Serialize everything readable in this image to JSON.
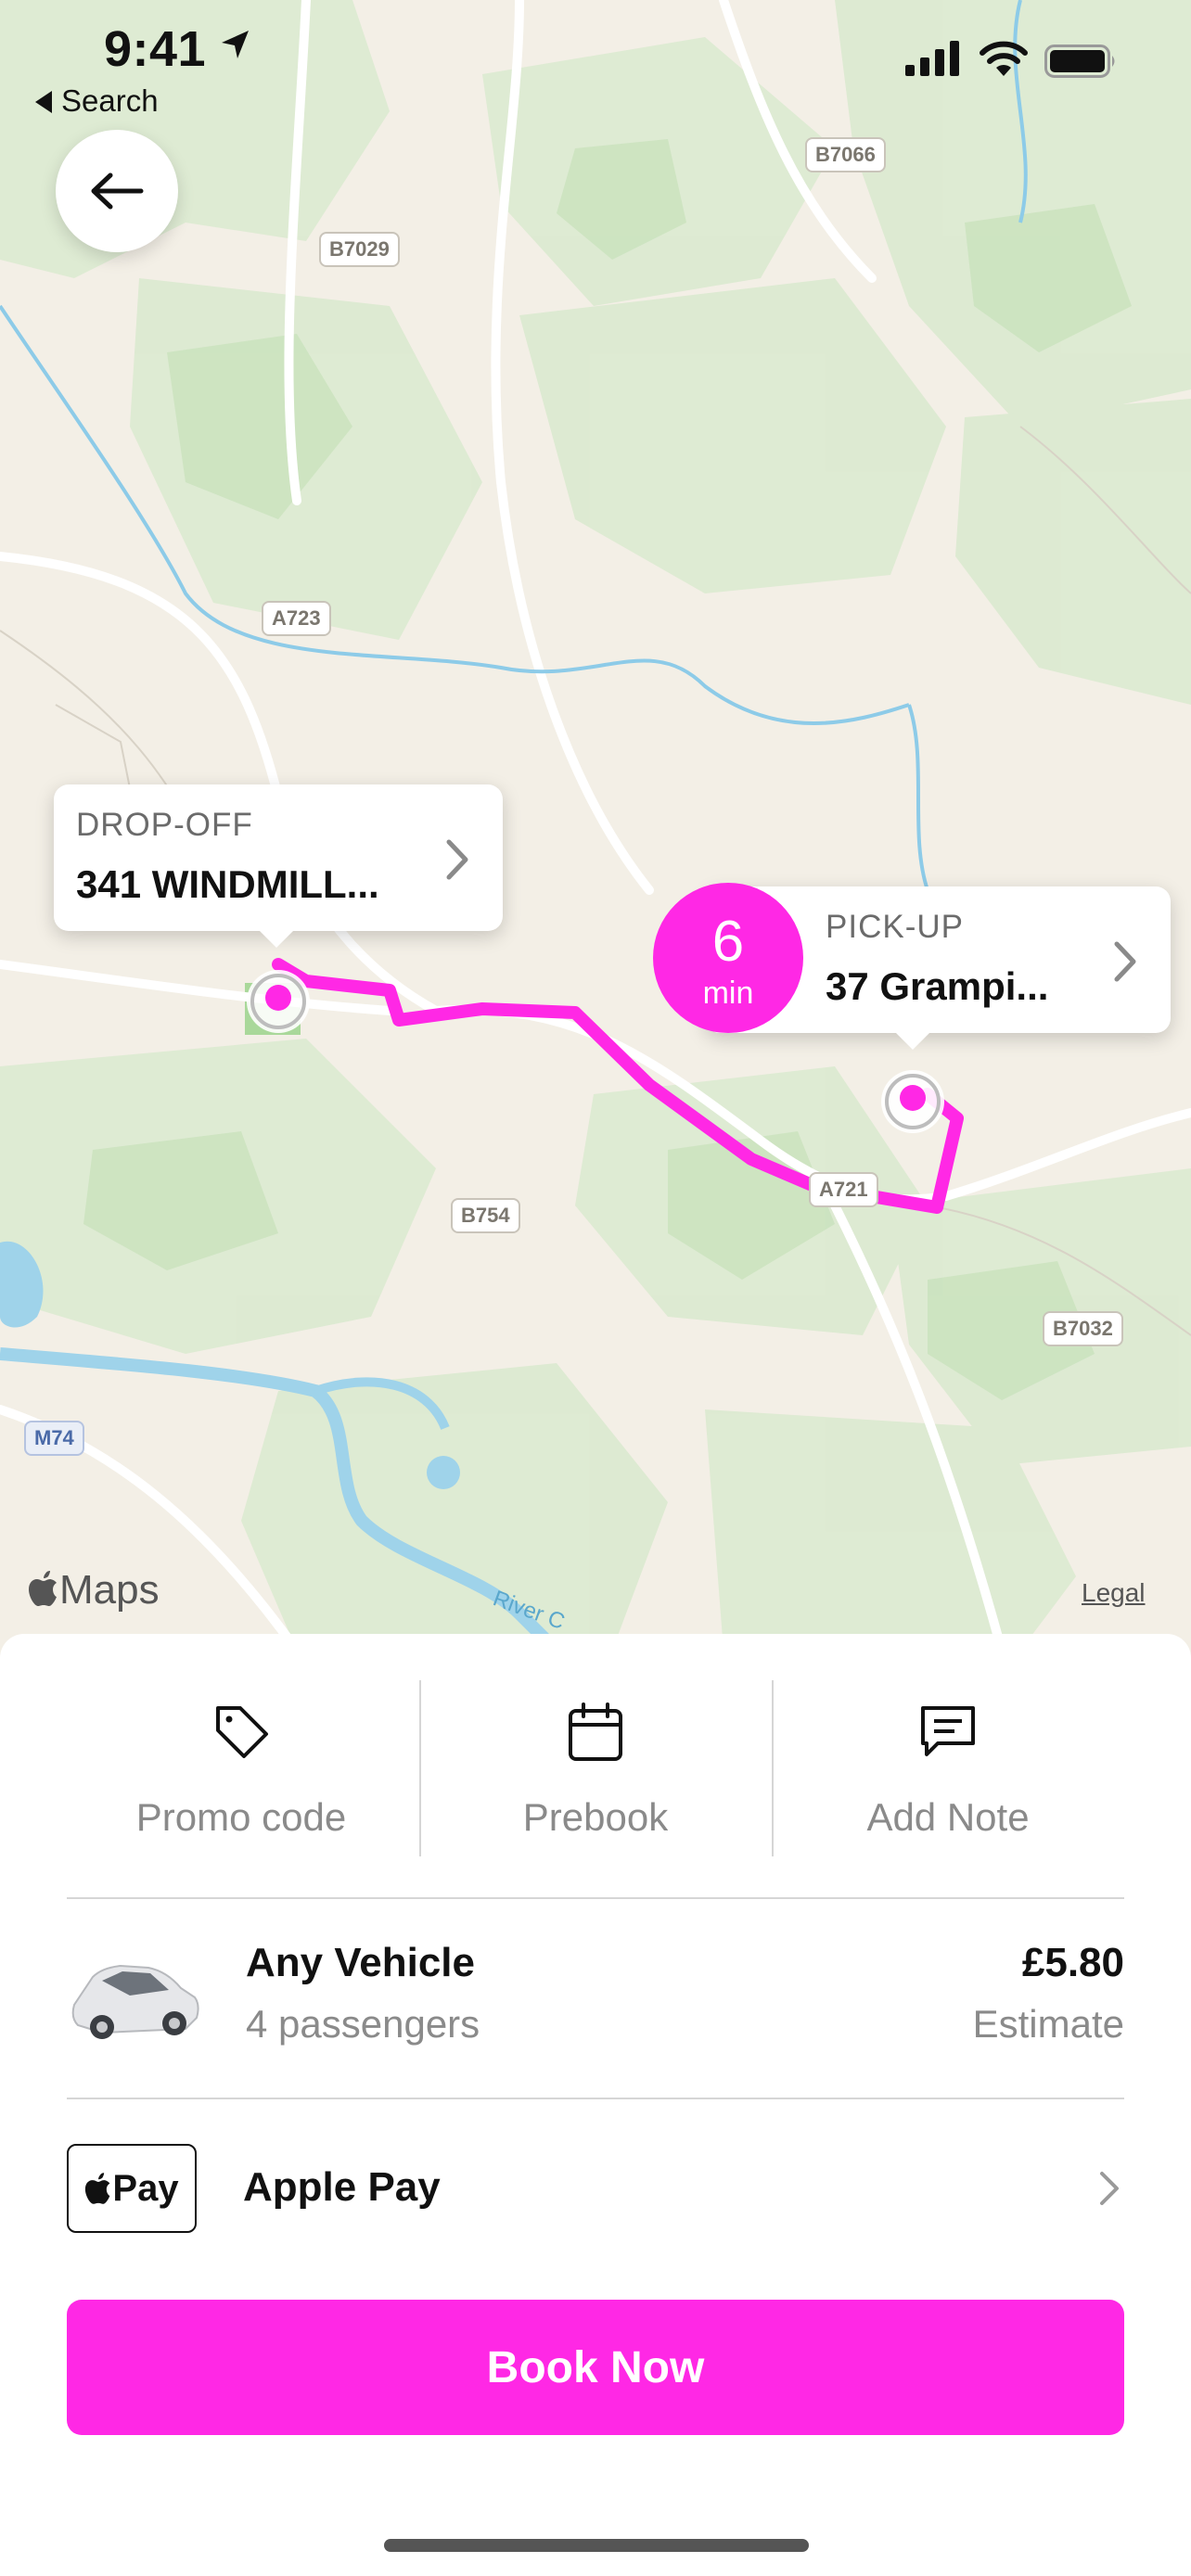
{
  "status_bar": {
    "time": "9:41",
    "back_app": "Search"
  },
  "map": {
    "road_labels": [
      "B7066",
      "B7029",
      "A723",
      "B754",
      "A721",
      "B7032",
      "M74"
    ],
    "river_label": "River C",
    "attribution": "Maps",
    "legal": "Legal",
    "route_color": "#ff28e5"
  },
  "dropoff": {
    "label": "DROP-OFF",
    "address": "341 WINDMILL..."
  },
  "pickup": {
    "label": "PICK-UP",
    "address": "37 Grampi...",
    "eta_value": "6",
    "eta_unit": "min"
  },
  "actions": [
    {
      "label": "Promo code",
      "icon": "tag-icon"
    },
    {
      "label": "Prebook",
      "icon": "calendar-icon"
    },
    {
      "label": "Add Note",
      "icon": "note-icon"
    }
  ],
  "vehicle": {
    "name": "Any Vehicle",
    "passengers": "4 passengers",
    "price": "£5.80",
    "price_note": "Estimate"
  },
  "payment": {
    "badge": "Pay",
    "label": "Apple Pay"
  },
  "book_button": "Book Now",
  "accent_color": "#ff28e5"
}
